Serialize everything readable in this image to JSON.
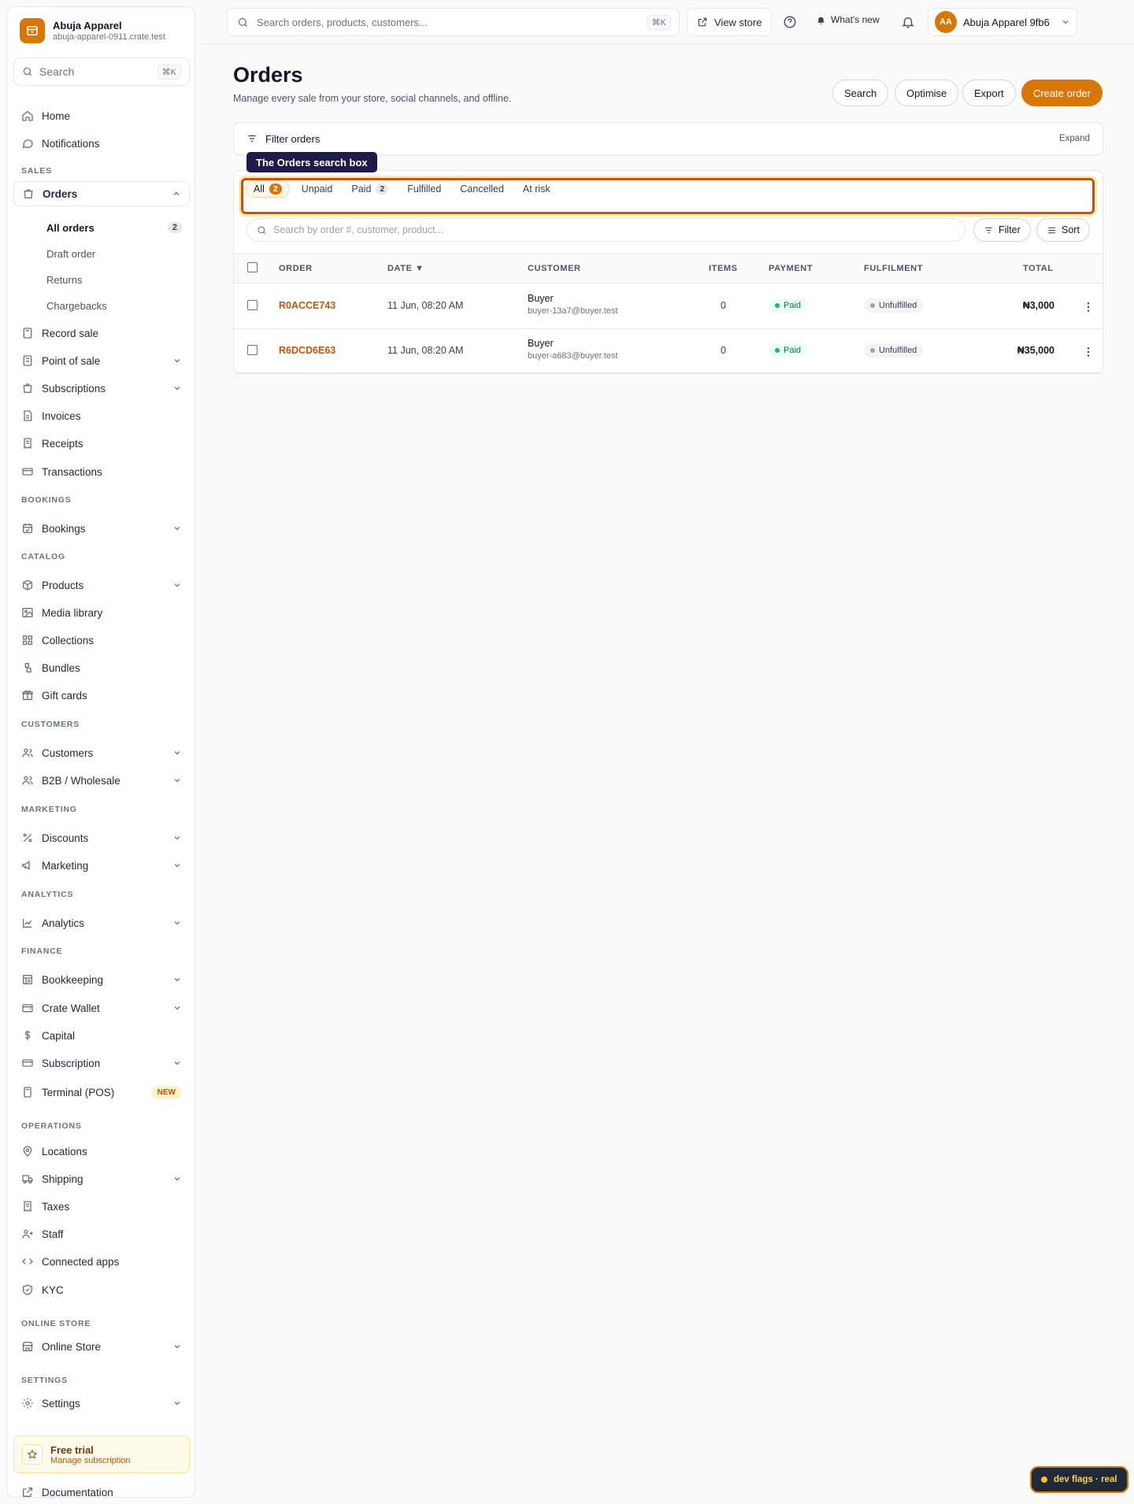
{
  "brand": {
    "name": "Abuja Apparel",
    "domain": "abuja-apparel-0911.crate.test"
  },
  "sidebar": {
    "search_label": "Search",
    "search_kbd": "⌘K",
    "home": "Home",
    "notifications": "Notifications",
    "sections": {
      "sales": "SALES",
      "bookings": "BOOKINGS",
      "catalog": "CATALOG",
      "customers": "CUSTOMERS",
      "marketing": "MARKETING",
      "analytics": "ANALYTICS",
      "finance": "FINANCE",
      "operations": "OPERATIONS",
      "online_store": "ONLINE STORE",
      "settings": "SETTINGS"
    },
    "orders": "Orders",
    "orders_sub": {
      "all": "All orders",
      "all_count": "2",
      "draft": "Draft order",
      "returns": "Returns",
      "chargebacks": "Chargebacks"
    },
    "record_sale": "Record sale",
    "point_of_sale": "Point of sale",
    "subscriptions": "Subscriptions",
    "invoices": "Invoices",
    "receipts": "Receipts",
    "transactions": "Transactions",
    "bookings": "Bookings",
    "products": "Products",
    "media_library": "Media library",
    "collections": "Collections",
    "bundles": "Bundles",
    "gift_cards": "Gift cards",
    "customers": "Customers",
    "b2b": "B2B / Wholesale",
    "discounts": "Discounts",
    "marketing": "Marketing",
    "analytics": "Analytics",
    "bookkeeping": "Bookkeeping",
    "crate_wallet": "Crate Wallet",
    "capital": "Capital",
    "subscription": "Subscription",
    "terminal": "Terminal (POS)",
    "terminal_badge": "NEW",
    "locations": "Locations",
    "shipping": "Shipping",
    "taxes": "Taxes",
    "staff": "Staff",
    "connected_apps": "Connected apps",
    "kyc": "KYC",
    "online_store": "Online Store",
    "settings": "Settings",
    "trial_title": "Free trial",
    "trial_sub": "Manage subscription",
    "documentation": "Documentation"
  },
  "topbar": {
    "search_placeholder": "Search orders, products, customers...",
    "search_kbd": "⌘K",
    "view_store": "View store",
    "whats_new": "What's new",
    "account_initials": "AA",
    "account_name": "Abuja Apparel 9fb6"
  },
  "page": {
    "title": "Orders",
    "subtitle": "Manage every sale from your store, social channels, and offline.",
    "actions": {
      "search": "Search",
      "optimise": "Optimise",
      "export": "Export",
      "create": "Create order"
    },
    "filter_title": "Filter orders",
    "filter_expand": "Expand",
    "tooltip": "The Orders search box",
    "tabs": [
      {
        "label": "All",
        "count": "2"
      },
      {
        "label": "Unpaid"
      },
      {
        "label": "Paid",
        "count": "2"
      },
      {
        "label": "Fulfilled"
      },
      {
        "label": "Cancelled"
      },
      {
        "label": "At risk"
      }
    ],
    "order_search_placeholder": "Search by order #, customer, product...",
    "filter_btn": "Filter",
    "sort_btn": "Sort"
  },
  "table": {
    "headers": {
      "order": "ORDER",
      "date": "DATE ▼",
      "customer": "CUSTOMER",
      "items": "ITEMS",
      "payment": "PAYMENT",
      "fulfilment": "FULFILMENT",
      "total": "TOTAL"
    },
    "rows": [
      {
        "order": "R0ACCE743",
        "date": "11 Jun, 08:20 AM",
        "customer": "Buyer",
        "email": "buyer-13a7@buyer.test",
        "items": "0",
        "payment": "Paid",
        "fulfilment": "Unfulfilled",
        "total": "₦3,000"
      },
      {
        "order": "R6DCD6E63",
        "date": "11 Jun, 08:20 AM",
        "customer": "Buyer",
        "email": "buyer-a683@buyer.test",
        "items": "0",
        "payment": "Paid",
        "fulfilment": "Unfulfilled",
        "total": "₦35,000"
      }
    ]
  },
  "dev_flags": "dev flags · real",
  "colors": {
    "accent": "#d97706",
    "tooltip_bg": "#1e1b4b",
    "highlight": "#c2570c"
  }
}
